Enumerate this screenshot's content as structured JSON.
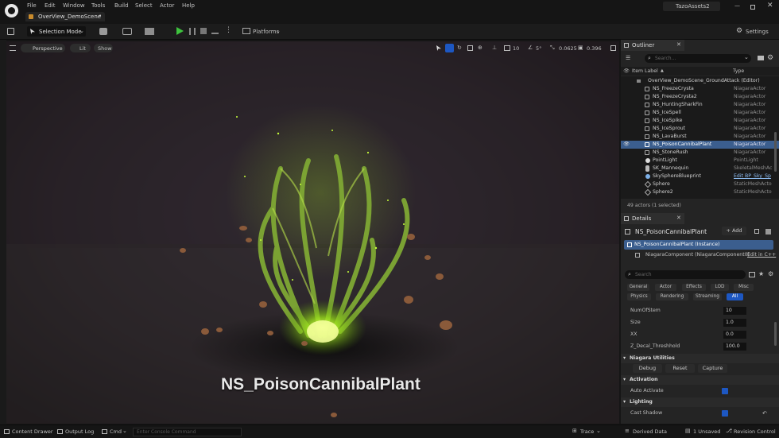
{
  "menu": {
    "items": [
      "File",
      "Edit",
      "Window",
      "Tools",
      "Build",
      "Select",
      "Actor",
      "Help"
    ],
    "tab": "OverView_DemoScene",
    "tab_dot": "•",
    "project": "TazoAssets2"
  },
  "toolbar": {
    "mode": "Selection Mode",
    "platforms": "Platforms",
    "settings": "Settings"
  },
  "viewport": {
    "perspective": "Perspective",
    "lit": "Lit",
    "show": "Show",
    "grid": "10",
    "angle": "5°",
    "scale": "0.0625",
    "camera": "0.396",
    "overlay_title": "NS_PoisonCannibalPlant"
  },
  "outliner": {
    "title": "Outliner",
    "search_placeholder": "Search...",
    "col_label": "Item Label",
    "col_sort": "▲",
    "col_type": "Type",
    "rows": [
      {
        "label": "OverView_DemoScene_GroundAttack (Editor)",
        "type": ""
      },
      {
        "label": "NS_FreezeCrysta",
        "type": "NiagaraActor"
      },
      {
        "label": "NS_FreezeCrysta2",
        "type": "NiagaraActor"
      },
      {
        "label": "NS_HuntingSharkFin",
        "type": "NiagaraActor"
      },
      {
        "label": "NS_IceSpell",
        "type": "NiagaraActor"
      },
      {
        "label": "NS_IceSpike",
        "type": "NiagaraActor"
      },
      {
        "label": "NS_IceSprout",
        "type": "NiagaraActor"
      },
      {
        "label": "NS_LavaBurst",
        "type": "NiagaraActor"
      },
      {
        "label": "NS_PoisonCannibalPlant",
        "type": "NiagaraActor"
      },
      {
        "label": "NS_StoneRush",
        "type": "NiagaraActor"
      },
      {
        "label": "PointLight",
        "type": "PointLight"
      },
      {
        "label": "SK_Mannequin",
        "type": "SkeletalMeshAc"
      },
      {
        "label": "SkySphereBlueprint",
        "type": "Edit BP_Sky_Sp"
      },
      {
        "label": "Sphere",
        "type": "StaticMeshActo"
      },
      {
        "label": "Sphere2",
        "type": "StaticMeshActo"
      }
    ],
    "count": "49 actors (1 selected)"
  },
  "details": {
    "title": "Details",
    "actor": "NS_PoisonCannibalPlant",
    "add": "+ Add",
    "instance": "NS_PoisonCannibalPlant (Instance)",
    "component": "NiagaraComponent (NiagaraComponent0)",
    "edit_cpp": "Edit in C++",
    "search_placeholder": "Search",
    "tabs_row1": [
      "General",
      "Actor",
      "Effects",
      "LOD",
      "Misc"
    ],
    "tabs_row2": [
      "Physics",
      "Rendering",
      "Streaming",
      "All"
    ],
    "props": [
      {
        "label": "NumOfStem",
        "value": "10"
      },
      {
        "label": "Size",
        "value": "1.0"
      },
      {
        "label": "XX",
        "value": "0.0"
      },
      {
        "label": "Z_Decal_Threshhold",
        "value": "100.0"
      }
    ],
    "sec_niagara": "Niagara Utilities",
    "debug": "Debug",
    "reset": "Reset",
    "capture": "Capture",
    "sec_activation": "Activation",
    "auto_activate": "Auto Activate",
    "sec_lighting": "Lighting",
    "cast_shadow": "Cast Shadow"
  },
  "statusbar": {
    "content_drawer": "Content Drawer",
    "output_log": "Output Log",
    "cmd": "Cmd",
    "console_placeholder": "Enter Console Command",
    "trace": "Trace",
    "derived_data": "Derived Data",
    "unsaved": "1 Unsaved",
    "revision": "Revision Control"
  },
  "colors": {
    "accent": "#1d57c2",
    "selected_row": "#3b5e8e",
    "glow": "#a6f21f"
  }
}
